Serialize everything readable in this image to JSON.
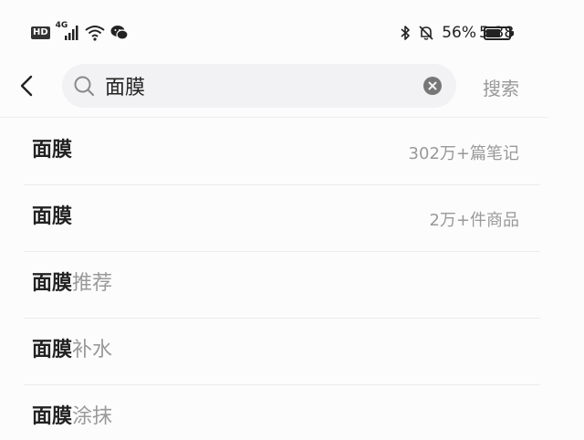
{
  "status_bar": {
    "hd": "HD",
    "network": "4G",
    "battery_percent": "56%",
    "battery_level": 0.56,
    "time": "5:38",
    "icons": [
      "hd-icon",
      "cell-signal-icon",
      "wifi-icon",
      "wechat-icon",
      "bluetooth-icon",
      "mute-bell-icon",
      "battery-icon"
    ]
  },
  "search": {
    "value": "面膜",
    "button_label": "搜索"
  },
  "suggestions": [
    {
      "main": "面膜",
      "suffix": "",
      "meta": "302万+篇笔记"
    },
    {
      "main": "面膜",
      "suffix": "",
      "meta": "2万+件商品"
    },
    {
      "main": "面膜",
      "suffix": "推荐",
      "meta": ""
    },
    {
      "main": "面膜",
      "suffix": "补水",
      "meta": ""
    },
    {
      "main": "面膜",
      "suffix": "涂抹",
      "meta": ""
    }
  ]
}
